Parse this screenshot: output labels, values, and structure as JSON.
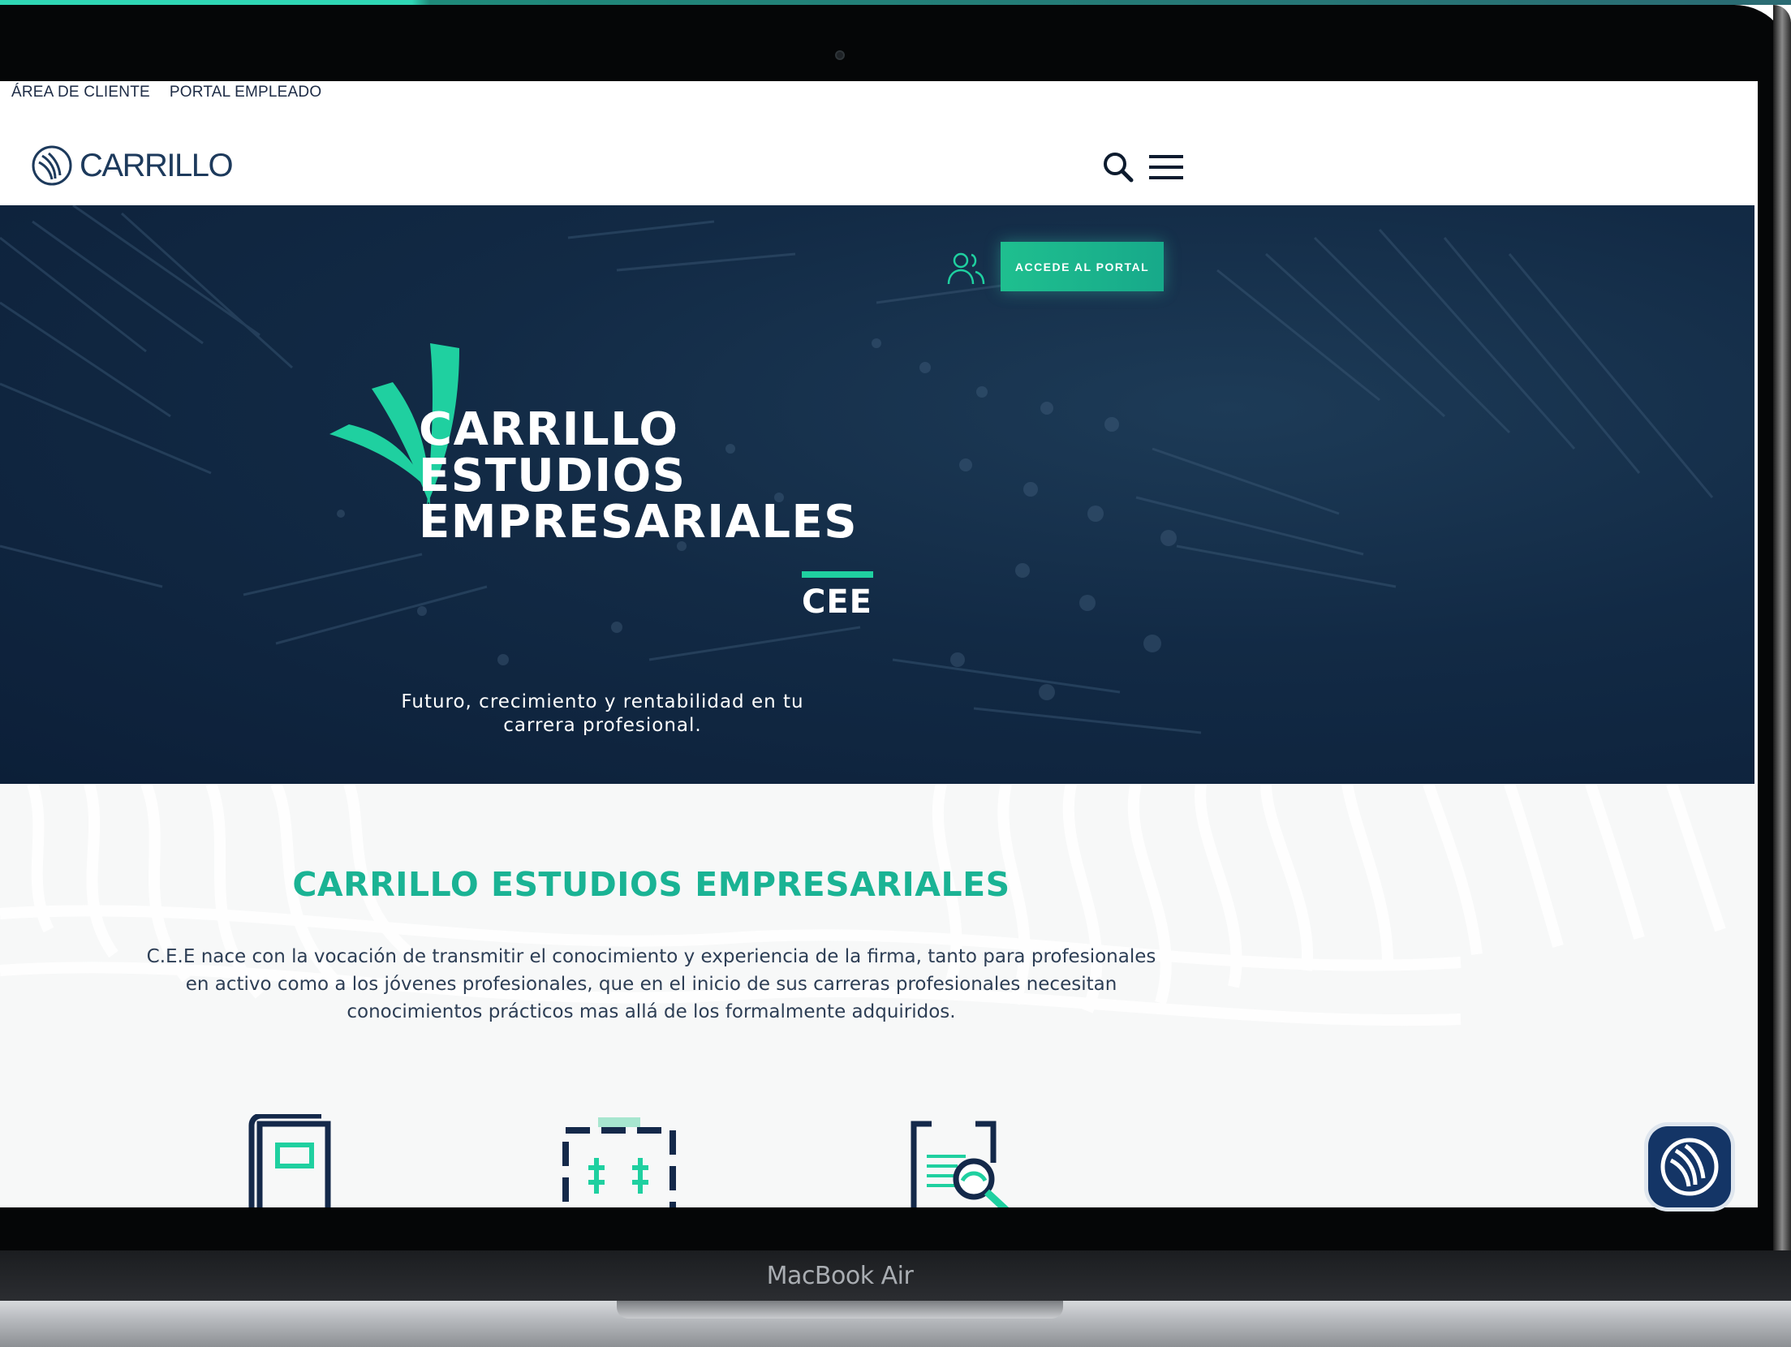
{
  "device": {
    "label": "MacBook Air"
  },
  "topbar": {
    "links": [
      "ÁREA DE CLIENTE",
      "PORTAL EMPLEADO"
    ]
  },
  "header": {
    "logo_text": "CARRILLO",
    "search_icon": "search-icon",
    "menu_icon": "hamburger-menu-icon"
  },
  "hero": {
    "portal_icon": "users-icon",
    "portal_button": "ACCEDE AL PORTAL",
    "title_lines": [
      "CARRILLO",
      "ESTUDIOS",
      "EMPRESARIALES"
    ],
    "abbreviation": "CEE",
    "tagline_lines": [
      "Futuro, crecimiento y rentabilidad en tu",
      "carrera profesional."
    ]
  },
  "intro": {
    "title": "CARRILLO ESTUDIOS EMPRESARIALES",
    "body_lines": [
      "C.E.E nace con la vocación de transmitir el conocimiento y experiencia de la firma, tanto para profesionales",
      "en activo como a los jóvenes profesionales, que en el inicio de sus carreras profesionales necesitan",
      "conocimientos prácticos mas allá de los formalmente adquiridos."
    ],
    "feature_icons": [
      "book-icon",
      "briefcase-icon",
      "document-search-icon"
    ]
  },
  "chat": {
    "icon": "carrillo-logo-icon"
  },
  "colors": {
    "navy": "#0f2440",
    "accent": "#1ab394",
    "text": "#2d3e55"
  }
}
